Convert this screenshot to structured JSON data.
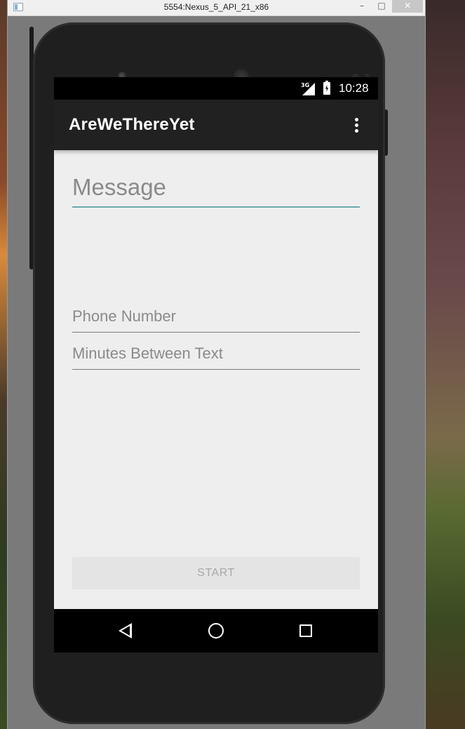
{
  "window": {
    "title": "5554:Nexus_5_API_21_x86",
    "minimize_label": "–",
    "maximize_label": "□",
    "close_label": "✕"
  },
  "statusbar": {
    "network": "3G",
    "time": "10:28"
  },
  "app": {
    "title": "AreWeThereYet"
  },
  "form": {
    "message_placeholder": "Message",
    "phone_placeholder": "Phone Number",
    "minutes_placeholder": "Minutes Between Text",
    "start_label": "START"
  },
  "icons": {
    "overflow": "more-vert-icon",
    "back": "back-icon",
    "home": "home-icon",
    "recents": "recents-icon"
  }
}
